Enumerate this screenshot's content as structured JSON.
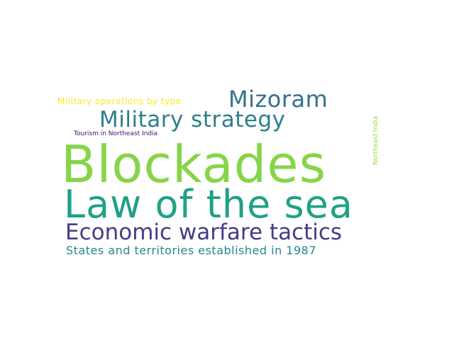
{
  "words": [
    {
      "text": "Blockades",
      "color": "#86d549"
    },
    {
      "text": "Law of the sea",
      "color": "#1fa187"
    },
    {
      "text": "Economic warfare tactics",
      "color": "#433e85"
    },
    {
      "text": "Military strategy",
      "color": "#2c7f8e"
    },
    {
      "text": "Mizoram",
      "color": "#35718c"
    },
    {
      "text": "States and territories established in 1987",
      "color": "#23888e"
    },
    {
      "text": "Military operations by type",
      "color": "#fde725"
    },
    {
      "text": "Tourism in Northeast India",
      "color": "#440f67"
    },
    {
      "text": "Northeast India",
      "color": "#a0da39"
    }
  ]
}
